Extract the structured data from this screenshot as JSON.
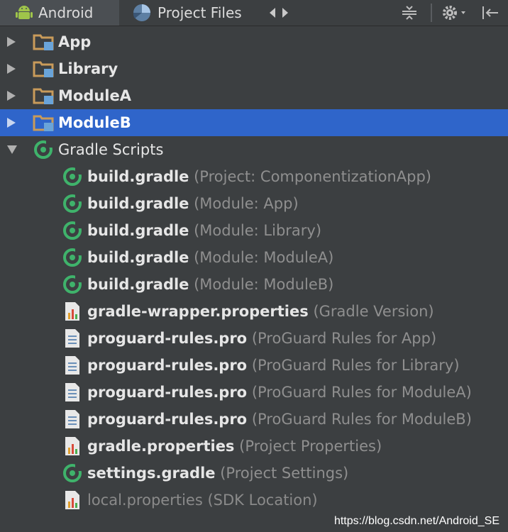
{
  "tabs": {
    "android": "Android",
    "project_files": "Project Files"
  },
  "tree": {
    "modules": [
      "App",
      "Library",
      "ModuleA",
      "ModuleB"
    ],
    "selected": "ModuleB",
    "gradle_scripts": "Gradle Scripts",
    "files": [
      {
        "name": "build.gradle",
        "hint": "(Project: ComponentizationApp)",
        "icon": "gradle-icon"
      },
      {
        "name": "build.gradle",
        "hint": "(Module: App)",
        "icon": "gradle-icon"
      },
      {
        "name": "build.gradle",
        "hint": "(Module: Library)",
        "icon": "gradle-icon"
      },
      {
        "name": "build.gradle",
        "hint": "(Module: ModuleA)",
        "icon": "gradle-icon"
      },
      {
        "name": "build.gradle",
        "hint": "(Module: ModuleB)",
        "icon": "gradle-icon"
      },
      {
        "name": "gradle-wrapper.properties",
        "hint": "(Gradle Version)",
        "icon": "properties-icon"
      },
      {
        "name": "proguard-rules.pro",
        "hint": "(ProGuard Rules for App)",
        "icon": "text-file-icon"
      },
      {
        "name": "proguard-rules.pro",
        "hint": "(ProGuard Rules for Library)",
        "icon": "text-file-icon"
      },
      {
        "name": "proguard-rules.pro",
        "hint": "(ProGuard Rules for ModuleA)",
        "icon": "text-file-icon"
      },
      {
        "name": "proguard-rules.pro",
        "hint": "(ProGuard Rules for ModuleB)",
        "icon": "text-file-icon"
      },
      {
        "name": "gradle.properties",
        "hint": "(Project Properties)",
        "icon": "properties-icon"
      },
      {
        "name": "settings.gradle",
        "hint": "(Project Settings)",
        "icon": "gradle-icon"
      },
      {
        "name": "local.properties",
        "hint": "(SDK Location)",
        "icon": "properties-icon"
      }
    ]
  },
  "watermark": "https://blog.csdn.net/Android_SE",
  "colors": {
    "background": "#3c3f41",
    "selection": "#2f65ca",
    "android_green": "#9fc54a",
    "gradle_green": "#3fb36b",
    "folder": "#c99b5a",
    "folder_badge": "#6aa4d9"
  }
}
